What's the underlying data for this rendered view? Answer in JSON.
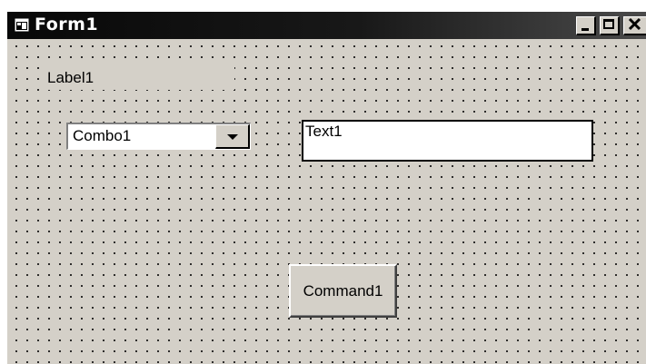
{
  "window": {
    "title": "Form1"
  },
  "form": {
    "label": "Label1",
    "combo": {
      "value": "Combo1"
    },
    "textbox": {
      "value": "Text1"
    },
    "command": {
      "label": "Command1"
    }
  }
}
